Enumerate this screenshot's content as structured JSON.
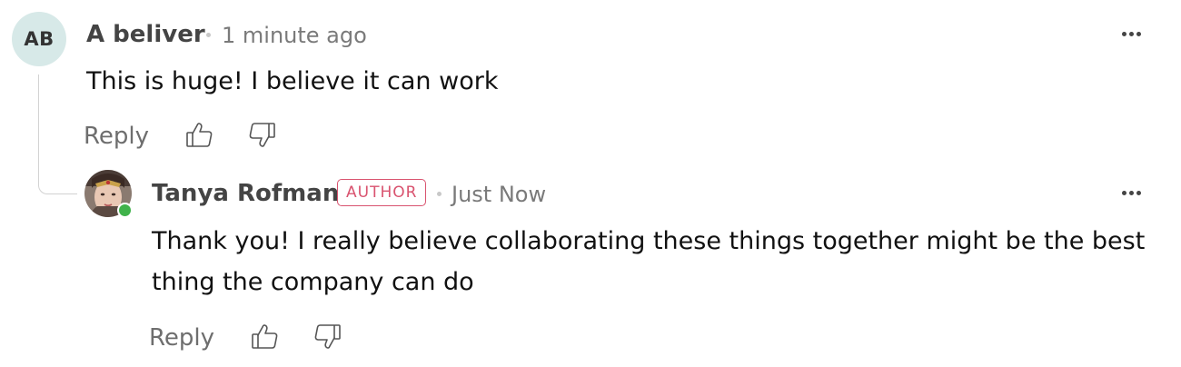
{
  "comments": [
    {
      "author": "A beliver",
      "avatar_initials": "AB",
      "timestamp": "1 minute ago",
      "text": "This is huge! I believe it can work",
      "reply_label": "Reply",
      "more_icon": "ellipsis-horizontal-icon",
      "upvote_icon": "thumbs-up-icon",
      "downvote_icon": "thumbs-down-icon",
      "avatar_color": "#d7e9e8"
    },
    {
      "author": "Tanya Rofman",
      "badge": "AUTHOR",
      "timestamp": "Just Now",
      "text": "Thank you! I really believe collaborating these things together might be the best thing the company can do",
      "reply_label": "Reply",
      "online": true,
      "more_icon": "ellipsis-horizontal-icon",
      "upvote_icon": "thumbs-up-icon",
      "downvote_icon": "thumbs-down-icon",
      "badge_color": "#d9536f",
      "online_color": "#3fb24a"
    }
  ]
}
